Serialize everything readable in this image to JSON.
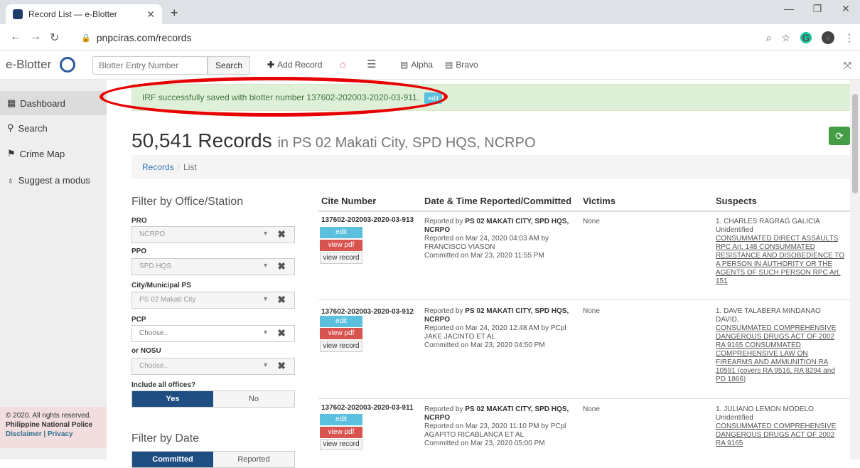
{
  "browser": {
    "tab_title": "Record List — e-Blotter",
    "url": "pnpciras.com/records"
  },
  "nav": {
    "brand": "e-Blotter",
    "search_placeholder": "Blotter Entry Number",
    "search_btn": "Search",
    "add_record": "Add Record",
    "alpha": "Alpha",
    "bravo": "Bravo"
  },
  "sidebar": {
    "items": [
      {
        "label": "Dashboard"
      },
      {
        "label": "Search"
      },
      {
        "label": "Crime Map"
      },
      {
        "label": "Suggest a modus"
      }
    ]
  },
  "footer": {
    "copyright": "© 2020. All rights reserved.",
    "org": "Philippine National Police",
    "links": "Disclaimer | Privacy"
  },
  "alert": {
    "text": "IRF successfully saved with blotter number 137602-202003-2020-03-911.",
    "edit": "edit"
  },
  "page": {
    "count": "50,541",
    "title_word": "Records",
    "location": "in PS 02 Makati City, SPD HQS, NCRPO"
  },
  "breadcrumb": {
    "a": "Records",
    "b": "List"
  },
  "filters": {
    "heading": "Filter by Office/Station",
    "pro_label": "PRO",
    "pro_value": "NCRPO",
    "ppo_label": "PPO",
    "ppo_value": "SPD HQS",
    "city_label": "City/Municipal PS",
    "city_value": "PS 02 Makati City",
    "pcp_label": "PCP",
    "pcp_value": "Choose..",
    "nosu_label": "or NOSU",
    "nosu_value": "Choose..",
    "include_label": "Include all offices?",
    "yes": "Yes",
    "no": "No",
    "date_heading": "Filter by Date",
    "committed": "Committed",
    "reported": "Reported"
  },
  "table": {
    "headers": [
      "Cite Number",
      "Date & Time Reported/Committed",
      "Victims",
      "Suspects"
    ],
    "btn_edit": "edit",
    "btn_pdf": "view pdf",
    "btn_view": "view record",
    "rows": [
      {
        "cite": "137602-202003-2020-03-913",
        "rep1": "Reported by ",
        "rep_b": "PS 02 MAKATI CITY, SPD HQS, NCRPO",
        "rep2": "Reported on Mar 24, 2020 04:03 AM by FRANCISCO VIASON",
        "committed": "Committed on Mar 23, 2020 11:55 PM",
        "victims": "None",
        "suspect": "1. CHARLES RAGRAG GALICIA Unidentified",
        "charges": "CONSUMMATED DIRECT ASSAULTS RPC Art. 148 CONSUMMATED RESISTANCE AND DISOBEDIENCE TO A PERSON IN AUTHORITY OR THE AGENTS OF SUCH PERSON RPC Art. 151"
      },
      {
        "cite": "137602-202003-2020-03-912",
        "rep1": "Reported by ",
        "rep_b": "PS 02 MAKATI CITY, SPD HQS, NCRPO",
        "rep2": "Reported on Mar 24, 2020 12:48 AM by PCpl JAKE JACINTO ET AL",
        "committed": "Committed on Mar 23, 2020 04:50 PM",
        "victims": "None",
        "suspect": "1. DAVE TALABERA MINDANAO DAVID,",
        "charges": "CONSUMMATED COMPREHENSIVE DANGEROUS DRUGS ACT OF 2002 RA 9165 CONSUMMATED COMPREHENSIVE LAW ON FIREARMS AND AMMUNITION RA 10591 (covers RA 9516, RA 8294 and PD 1866)"
      },
      {
        "cite": "137602-202003-2020-03-911",
        "rep1": "Reported by ",
        "rep_b": "PS 02 MAKATI CITY, SPD HQS, NCRPO",
        "rep2": "Reported on Mar 23, 2020 11:10 PM by PCpl AGAPITO RICABLANCA ET AL",
        "committed": "Committed on Mar 23, 2020 05:00 PM",
        "victims": "None",
        "suspect": "1. JULIANO LEMON MODELO Unidentified",
        "charges": "CONSUMMATED COMPREHENSIVE DANGEROUS DRUGS ACT OF 2002 RA 9165"
      }
    ]
  },
  "colors": {
    "alert_bg": "#dff0d8",
    "highlight": "#e60000",
    "primary": "#1e4e82",
    "edit": "#5bc0de",
    "pdf": "#d9534f"
  }
}
